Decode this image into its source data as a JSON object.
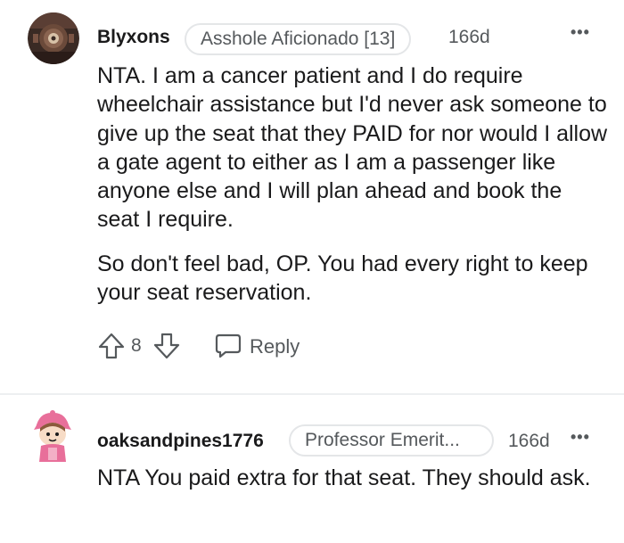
{
  "comments": [
    {
      "username": "Blyxons",
      "flair": "Asshole Aficionado [13]",
      "time": "166d",
      "more": "•••",
      "paragraphs": [
        "NTA. I am a cancer patient and I do require wheelchair assistance but I'd never ask someone to give up the seat that they PAID for nor would I allow a gate agent to either as I am a passenger like anyone else and I will plan ahead and book the seat I require.",
        "So don't feel bad, OP. You had every right to keep your seat reservation."
      ],
      "score": "8",
      "reply_label": "Reply"
    },
    {
      "username": "oaksandpines1776",
      "flair": "Professor Emerit...",
      "time": "166d",
      "more": "•••",
      "paragraphs": [
        "NTA You paid extra for that seat. They should ask."
      ]
    }
  ],
  "colors": {
    "text": "#1a1a1b",
    "meta": "#55595c",
    "flair_border": "#e4e6e8",
    "divider": "#edeff1"
  },
  "icons": {
    "upvote": "arrow-up-outline-icon",
    "downvote": "arrow-down-outline-icon",
    "reply": "speech-bubble-icon",
    "more": "horizontal-dots-icon"
  }
}
